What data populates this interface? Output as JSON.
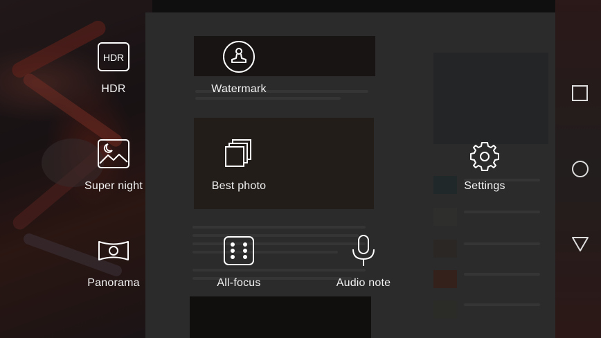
{
  "modes": [
    {
      "id": "hdr",
      "label": "HDR",
      "icon": "hdr-icon",
      "badge": "HDR"
    },
    {
      "id": "watermark",
      "label": "Watermark",
      "icon": "watermark-stamp-icon"
    },
    {
      "id": "super_night",
      "label": "Super night",
      "icon": "moon-landscape-icon"
    },
    {
      "id": "best_photo",
      "label": "Best photo",
      "icon": "stacked-frames-icon"
    },
    {
      "id": "settings",
      "label": "Settings",
      "icon": "gear-icon"
    },
    {
      "id": "panorama",
      "label": "Panorama",
      "icon": "panorama-icon"
    },
    {
      "id": "all_focus",
      "label": "All-focus",
      "icon": "dots-grid-icon"
    },
    {
      "id": "audio_note",
      "label": "Audio note",
      "icon": "microphone-icon"
    }
  ],
  "navbar": {
    "recents": "square-icon",
    "home": "circle-icon",
    "back": "triangle-back-icon"
  },
  "colors": {
    "text": "#ffffff",
    "overlay": "rgba(0,0,0,0.42)"
  }
}
